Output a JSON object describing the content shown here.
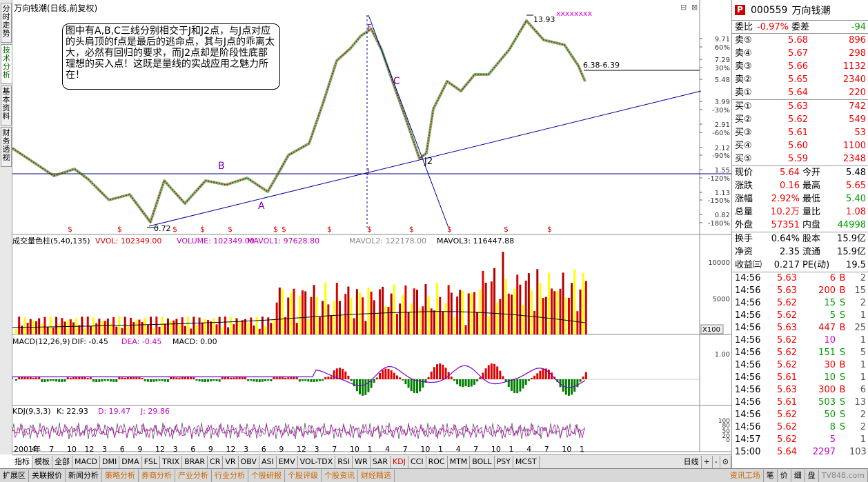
{
  "left_tabs": [
    "分时走势",
    "技术分析",
    "基本资料",
    "财务透视"
  ],
  "chart": {
    "title": "万向钱潮(日线,前复权)",
    "high_label": "13.93",
    "low_label": "0.72",
    "range_label": "6.38-6.39",
    "letters": [
      "B",
      "A",
      "C",
      "J",
      "J2",
      "F"
    ],
    "year_label": "2001年",
    "price_axis": [
      "9.71",
      "60%",
      "7.29",
      "30%",
      "5.48",
      "3.99",
      "-30%",
      "2.91",
      "-60%",
      "2.12",
      "-90%",
      "1.55",
      "-120%",
      "1.13",
      "-150%",
      "0.82",
      "-180%"
    ],
    "annotation": "图中有A,B,C三线分别相交于J和J2点，与J点对应的头肩顶的f点是最后的逃命点，其与J点的乖离太大，必然有回归的要求，而J2点却是阶段性底部理想的买入点！这既是量线的实战应用之魅力所在！",
    "x_ticks": [
      "2001年",
      "4",
      "7",
      "10",
      "12",
      "3",
      "6",
      "9",
      "12",
      "3",
      "6",
      "9",
      "12",
      "3",
      "6",
      "9",
      "12",
      "3",
      "7",
      "10",
      "1",
      "4",
      "7",
      "10",
      "1",
      "4",
      "7",
      "10",
      "1",
      "4",
      "7",
      "10",
      "1"
    ],
    "dollar_mark": "$",
    "vol": {
      "l0": "成交量色柱(5,40,135)",
      "l1": "VVOL: 102349.00",
      "l2": "VOLUME: 102349.00",
      "l3": "MAVOL1: 97628.80",
      "l4": "MAVOL2: 122178.00",
      "l5": "MAVOL3: 116447.88",
      "ax1": "10000",
      "ax2": "5000",
      "mult": "X100"
    },
    "macd": {
      "l0": "MACD(12,26,9)",
      "l1": "DIF: -0.45",
      "l2": "DEA: -0.45",
      "l3": "MACD: 0.00",
      "ax": "1.00"
    },
    "kdj": {
      "l0": "KDJ(9,3,3)",
      "l1": "K: 22.93",
      "l2": "D: 19.47",
      "l3": "J: 29.86",
      "ax": [
        "100",
        "80",
        "50",
        "20",
        "0"
      ]
    },
    "arrow_up": "↑",
    "arrow_down": "↓"
  },
  "quote": {
    "code": "000559",
    "name": "万向钱潮",
    "logo": "P",
    "wb_label": "委比",
    "wb": "-0.97%",
    "wc_label": "委差",
    "wc": "-94",
    "asks": [
      {
        "l": "卖⑤",
        "p": "5.68",
        "v": "896"
      },
      {
        "l": "卖④",
        "p": "5.67",
        "v": "298"
      },
      {
        "l": "卖③",
        "p": "5.66",
        "v": "1132"
      },
      {
        "l": "卖②",
        "p": "5.65",
        "v": "2340"
      },
      {
        "l": "卖①",
        "p": "5.64",
        "v": "220"
      }
    ],
    "bids": [
      {
        "l": "买①",
        "p": "5.63",
        "v": "742"
      },
      {
        "l": "买②",
        "p": "5.62",
        "v": "549"
      },
      {
        "l": "买③",
        "p": "5.61",
        "v": "53"
      },
      {
        "l": "买④",
        "p": "5.60",
        "v": "1100"
      },
      {
        "l": "买⑤",
        "p": "5.59",
        "v": "2348"
      }
    ],
    "stats": [
      {
        "a": "现价",
        "b": "5.64",
        "c": "今开",
        "d": "5.48",
        "bc": "red",
        "dc": "black"
      },
      {
        "a": "涨跌",
        "b": "0.16",
        "c": "最高",
        "d": "5.65",
        "bc": "red",
        "dc": "red"
      },
      {
        "a": "涨幅",
        "b": "2.92%",
        "c": "最低",
        "d": "5.40",
        "bc": "red",
        "dc": "grn"
      },
      {
        "a": "总量",
        "b": "10.2万",
        "c": "量比",
        "d": "1.08",
        "bc": "red",
        "dc": "red"
      },
      {
        "a": "外盘",
        "b": "57351",
        "c": "内盘",
        "d": "44998",
        "bc": "red",
        "dc": "grn"
      }
    ],
    "stats2": [
      {
        "a": "换手",
        "b": "0.64%",
        "c": "股本",
        "d": "15.9亿"
      },
      {
        "a": "净资",
        "b": "2.35",
        "c": "流通",
        "d": "15.9亿"
      },
      {
        "a": "收益㈢",
        "b": "0.217",
        "c": "PE(动)",
        "d": "19.5"
      }
    ],
    "ticks": [
      {
        "t": "14:56",
        "p": "5.63",
        "v": "6",
        "s": "B",
        "n": "2"
      },
      {
        "t": "14:56",
        "p": "5.63",
        "v": "200",
        "s": "B",
        "n": "15"
      },
      {
        "t": "14:56",
        "p": "5.62",
        "v": "15",
        "s": "S",
        "n": "2"
      },
      {
        "t": "14:56",
        "p": "5.62",
        "v": "5",
        "s": "S",
        "n": "1"
      },
      {
        "t": "14:56",
        "p": "5.63",
        "v": "447",
        "s": "B",
        "n": "25"
      },
      {
        "t": "14:56",
        "p": "5.62",
        "v": "10",
        "s": "",
        "n": "1"
      },
      {
        "t": "14:56",
        "p": "5.62",
        "v": "151",
        "s": "S",
        "n": "5"
      },
      {
        "t": "14:56",
        "p": "5.62",
        "v": "30",
        "s": "B",
        "n": "1"
      },
      {
        "t": "14:56",
        "p": "5.61",
        "v": "10",
        "s": "S",
        "n": "1"
      },
      {
        "t": "14:56",
        "p": "5.63",
        "v": "300",
        "s": "B",
        "n": "6"
      },
      {
        "t": "14:56",
        "p": "5.61",
        "v": "503",
        "s": "S",
        "n": "13"
      },
      {
        "t": "14:56",
        "p": "5.62",
        "v": "50",
        "s": "S",
        "n": "2"
      },
      {
        "t": "14:56",
        "p": "5.62",
        "v": "8",
        "s": "S",
        "n": "2"
      },
      {
        "t": "14:57",
        "p": "5.62",
        "v": "5",
        "s": "",
        "n": "1"
      },
      {
        "t": "15:00",
        "p": "5.64",
        "v": "2297",
        "s": "",
        "n": "103"
      }
    ]
  },
  "bottom_tabs": [
    "指标",
    "模板",
    "全部",
    "MACD",
    "DMI",
    "DMA",
    "FSL",
    "TRIX",
    "BRAR",
    "CR",
    "VR",
    "OBV",
    "ASI",
    "EMV",
    "VOL-TDX",
    "RSI",
    "WR",
    "SAR",
    "KDJ",
    "CCI",
    "ROC",
    "MTM",
    "BOLL",
    "PSY",
    "MCST"
  ],
  "bottom_right": [
    "日线",
    "+",
    "-",
    "⊙"
  ],
  "status": {
    "left": [
      "扩展区",
      "关联报价",
      "新闻分析"
    ],
    "mid": [
      "策略分析",
      "券商分析",
      "产业分析",
      "行业分析",
      "个股研报",
      "个股评级",
      "个股资讯",
      "财经精选"
    ],
    "right": [
      "资讯工场",
      "笔",
      "价",
      "细",
      "盘"
    ],
    "watermark": "TV848.com"
  },
  "colors": {
    "up": "#e00000",
    "down": "#008000",
    "line": "#0000a0",
    "yellow": "#ffff00",
    "dif": "#7b00c8",
    "dea": "#c000c0"
  }
}
